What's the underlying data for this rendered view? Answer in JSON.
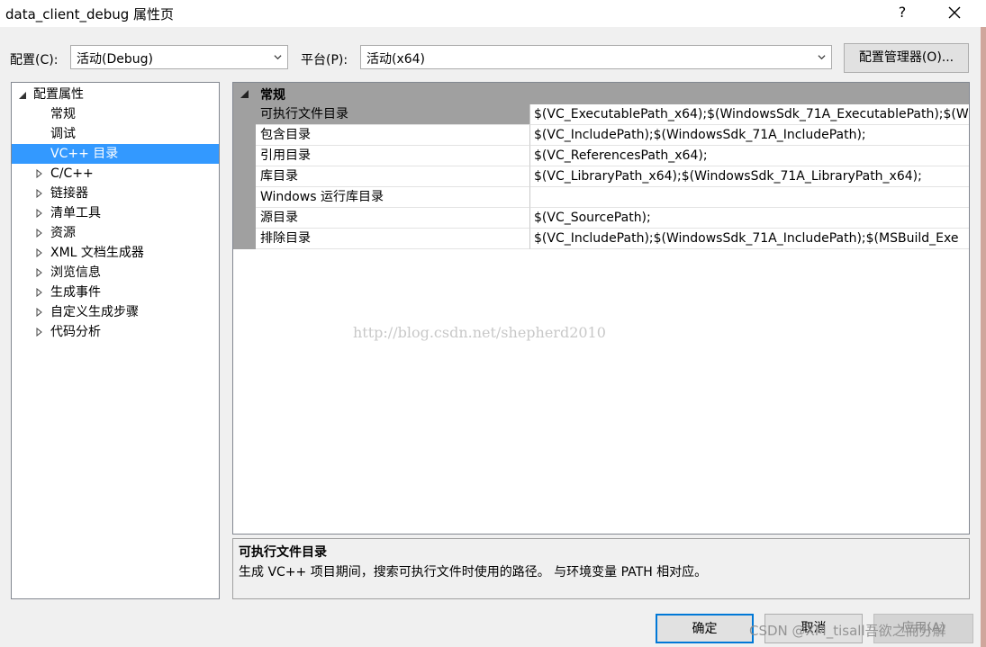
{
  "window": {
    "title": "data_client_debug 属性页",
    "help_label": "?",
    "close_label": "✕"
  },
  "toolbar": {
    "config_label": "配置(C):",
    "config_value": "活动(Debug)",
    "platform_label": "平台(P):",
    "platform_value": "活动(x64)",
    "config_manager_label": "配置管理器(O)..."
  },
  "tree": {
    "root": "配置属性",
    "items": [
      {
        "label": "常规",
        "expandable": false,
        "selected": false
      },
      {
        "label": "调试",
        "expandable": false,
        "selected": false
      },
      {
        "label": "VC++ 目录",
        "expandable": false,
        "selected": true
      },
      {
        "label": "C/C++",
        "expandable": true,
        "selected": false
      },
      {
        "label": "链接器",
        "expandable": true,
        "selected": false
      },
      {
        "label": "清单工具",
        "expandable": true,
        "selected": false
      },
      {
        "label": "资源",
        "expandable": true,
        "selected": false
      },
      {
        "label": "XML 文档生成器",
        "expandable": true,
        "selected": false
      },
      {
        "label": "浏览信息",
        "expandable": true,
        "selected": false
      },
      {
        "label": "生成事件",
        "expandable": true,
        "selected": false
      },
      {
        "label": "自定义生成步骤",
        "expandable": true,
        "selected": false
      },
      {
        "label": "代码分析",
        "expandable": true,
        "selected": false
      }
    ]
  },
  "grid": {
    "category": "常规",
    "rows": [
      {
        "name": "可执行文件目录",
        "value": "$(VC_ExecutablePath_x64);$(WindowsSdk_71A_ExecutablePath);$(W",
        "selected": true
      },
      {
        "name": "包含目录",
        "value": "$(VC_IncludePath);$(WindowsSdk_71A_IncludePath);",
        "selected": false
      },
      {
        "name": "引用目录",
        "value": "$(VC_ReferencesPath_x64);",
        "selected": false
      },
      {
        "name": "库目录",
        "value": "$(VC_LibraryPath_x64);$(WindowsSdk_71A_LibraryPath_x64);",
        "selected": false
      },
      {
        "name": "Windows 运行库目录",
        "value": "",
        "selected": false
      },
      {
        "name": "源目录",
        "value": "$(VC_SourcePath);",
        "selected": false
      },
      {
        "name": "排除目录",
        "value": "$(VC_IncludePath);$(WindowsSdk_71A_IncludePath);$(MSBuild_Exe",
        "selected": false
      }
    ]
  },
  "watermark": "http://blog.csdn.net/shepherd2010",
  "description": {
    "title": "可执行文件目录",
    "text": "生成 VC++ 项目期间，搜索可执行文件时使用的路径。 与环境变量 PATH 相对应。"
  },
  "buttons": {
    "ok": "确定",
    "cancel": "取消",
    "apply": "应用(A)"
  },
  "csdn_watermark": "CSDN @XM_tisall吾欲之而分解",
  "colors": {
    "selection": "#3399ff",
    "grid_header": "#a0a0a0",
    "window_bg": "#f0f0f0"
  }
}
